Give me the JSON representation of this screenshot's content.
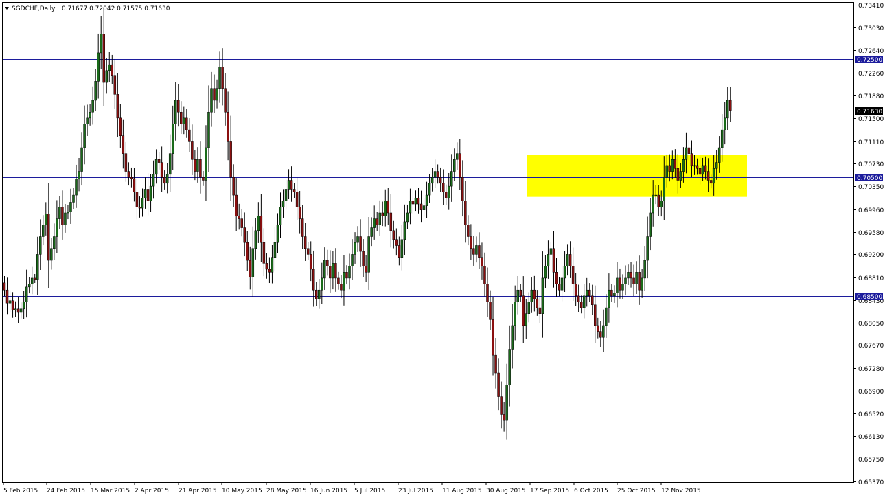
{
  "header": {
    "symbol_timeframe": "SGDCHF,Daily",
    "ohlc": "0.71677 0.72042 0.71575 0.71630"
  },
  "colors": {
    "background": "#ffffff",
    "bull_candle": "#1a6b1a",
    "bear_candle": "#8b1010",
    "wick": "#000000",
    "support_resistance_line": "#1c1c9c",
    "price_label_bg": "#1c1c9c",
    "current_price_bg": "#000000",
    "highlight_zone": "#ffff00"
  },
  "chart_data": {
    "type": "candlestick",
    "symbol": "SGDCHF",
    "timeframe": "Daily",
    "ylim": [
      0.6537,
      0.7341
    ],
    "y_ticks": [
      "0.73410",
      "0.73030",
      "0.72640",
      "0.72260",
      "0.71880",
      "0.71500",
      "0.71110",
      "0.70730",
      "0.70350",
      "0.69960",
      "0.69580",
      "0.69200",
      "0.68810",
      "0.68430",
      "0.68050",
      "0.67670",
      "0.67280",
      "0.66900",
      "0.66520",
      "0.66130",
      "0.65750",
      "0.65370"
    ],
    "x_ticks": [
      "5 Feb 2015",
      "24 Feb 2015",
      "15 Mar 2015",
      "2 Apr 2015",
      "21 Apr 2015",
      "10 May 2015",
      "28 May 2015",
      "16 Jun 2015",
      "5 Jul 2015",
      "23 Jul 2015",
      "11 Aug 2015",
      "30 Aug 2015",
      "17 Sep 2015",
      "6 Oct 2015",
      "25 Oct 2015",
      "12 Nov 2015"
    ],
    "horizontal_lines": [
      {
        "price": 0.725,
        "label": "0.72500"
      },
      {
        "price": 0.705,
        "label": "0.70500"
      },
      {
        "price": 0.685,
        "label": "0.68500"
      }
    ],
    "current_price": {
      "price": 0.7163,
      "label": "0.71630"
    },
    "highlight_zone": {
      "price_top": 0.7088,
      "price_bottom": 0.7017,
      "from_index": 190,
      "to_index": 232
    },
    "closes": [
      0.686,
      0.6838,
      0.6842,
      0.6826,
      0.6828,
      0.6822,
      0.6828,
      0.684,
      0.6865,
      0.687,
      0.688,
      0.6878,
      0.692,
      0.695,
      0.697,
      0.6988,
      0.691,
      0.693,
      0.695,
      0.698,
      0.7,
      0.697,
      0.699,
      0.6992,
      0.7008,
      0.702,
      0.7047,
      0.706,
      0.71,
      0.714,
      0.715,
      0.716,
      0.718,
      0.7212,
      0.726,
      0.7292,
      0.721,
      0.723,
      0.724,
      0.7222,
      0.719,
      0.715,
      0.712,
      0.709,
      0.706,
      0.705,
      0.7048,
      0.7025,
      0.7,
      0.6998,
      0.7015,
      0.703,
      0.701,
      0.7035,
      0.7055,
      0.708,
      0.7075,
      0.705,
      0.704,
      0.7055,
      0.709,
      0.714,
      0.718,
      0.716,
      0.714,
      0.715,
      0.713,
      0.711,
      0.708,
      0.706,
      0.708,
      0.705,
      0.7045,
      0.71,
      0.716,
      0.72,
      0.718,
      0.72,
      0.7236,
      0.72,
      0.716,
      0.711,
      0.705,
      0.702,
      0.6985,
      0.698,
      0.6965,
      0.694,
      0.691,
      0.6882,
      0.693,
      0.696,
      0.6985,
      0.694,
      0.6905,
      0.6895,
      0.689,
      0.6915,
      0.694,
      0.697,
      0.7,
      0.701,
      0.703,
      0.7045,
      0.703,
      0.7025,
      0.7,
      0.698,
      0.695,
      0.693,
      0.692,
      0.6895,
      0.686,
      0.6845,
      0.686,
      0.688,
      0.691,
      0.69,
      0.688,
      0.6905,
      0.688,
      0.687,
      0.686,
      0.689,
      0.688,
      0.69,
      0.692,
      0.694,
      0.695,
      0.6925,
      0.69,
      0.689,
      0.695,
      0.6965,
      0.698,
      0.697,
      0.699,
      0.6985,
      0.701,
      0.699,
      0.696,
      0.6945,
      0.6935,
      0.6915,
      0.6945,
      0.6975,
      0.699,
      0.701,
      0.7005,
      0.7015,
      0.7005,
      0.6995,
      0.7002,
      0.702,
      0.704,
      0.705,
      0.706,
      0.705,
      0.704,
      0.7025,
      0.7015,
      0.7035,
      0.706,
      0.708,
      0.709,
      0.705,
      0.701,
      0.697,
      0.695,
      0.693,
      0.692,
      0.6935,
      0.6915,
      0.69,
      0.687,
      0.684,
      0.681,
      0.675,
      0.672,
      0.668,
      0.665,
      0.664,
      0.67,
      0.676,
      0.68,
      0.684,
      0.686,
      0.685,
      0.68,
      0.682,
      0.684,
      0.686,
      0.6845,
      0.683,
      0.682,
      0.688,
      0.69,
      0.692,
      0.693,
      0.689,
      0.687,
      0.686,
      0.688,
      0.69,
      0.692,
      0.69,
      0.687,
      0.685,
      0.684,
      0.683,
      0.685,
      0.686,
      0.685,
      0.6835,
      0.68,
      0.679,
      0.678,
      0.68,
      0.683,
      0.686,
      0.685,
      0.6855,
      0.688,
      0.686,
      0.687,
      0.688,
      0.689,
      0.688,
      0.687,
      0.689,
      0.686,
      0.688,
      0.691,
      0.695,
      0.699,
      0.702,
      0.702,
      0.7,
      0.701,
      0.705,
      0.707,
      0.706,
      0.708,
      0.7065,
      0.7045,
      0.706,
      0.708,
      0.71,
      0.709,
      0.707,
      0.707,
      0.7065,
      0.7055,
      0.707,
      0.706,
      0.7045,
      0.704,
      0.7065,
      0.7075,
      0.71,
      0.713,
      0.715,
      0.718,
      0.7163
    ]
  }
}
